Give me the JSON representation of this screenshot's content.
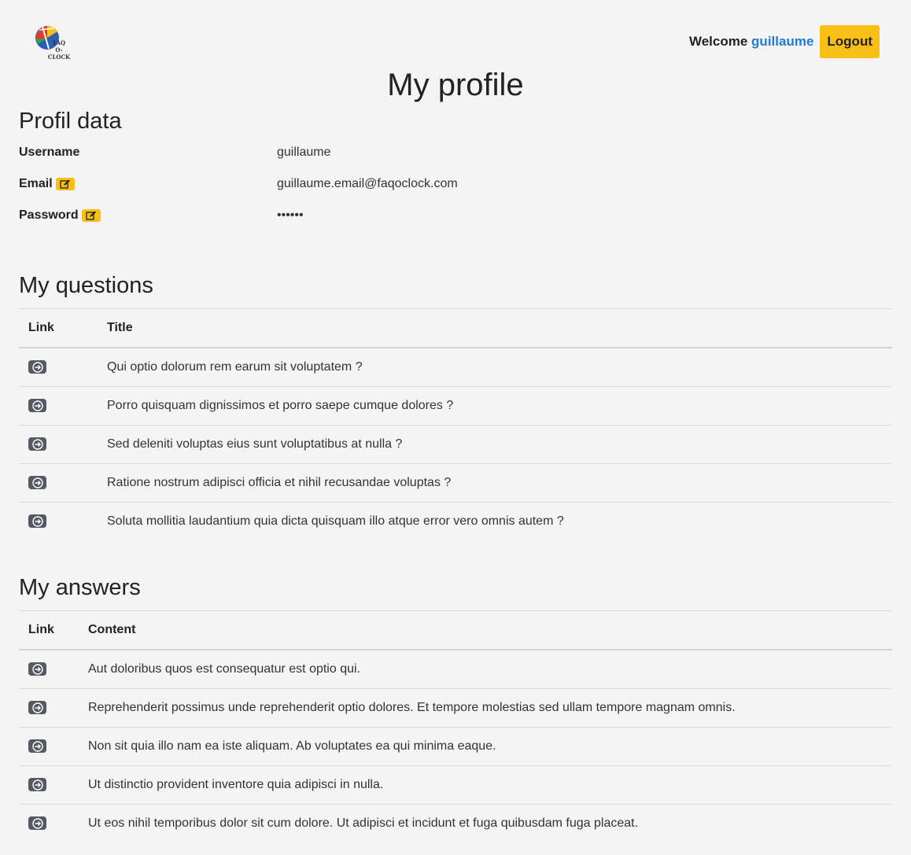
{
  "header": {
    "logo_text_line1": "FAQ",
    "logo_text_line2": "O-CLOCK",
    "welcome_label": "Welcome",
    "username": "guillaume",
    "logout_label": "Logout"
  },
  "page_title": "My profile",
  "profile": {
    "section_title": "Profil data",
    "fields": [
      {
        "label": "Username",
        "value": "guillaume"
      },
      {
        "label": "Email",
        "value": "guillaume.email@faqoclock.com"
      },
      {
        "label": "Password",
        "value": "••••••"
      }
    ]
  },
  "questions": {
    "section_title": "My questions",
    "columns": [
      "Link",
      "Title"
    ],
    "rows": [
      "Qui optio dolorum rem earum sit voluptatem ?",
      "Porro quisquam dignissimos et porro saepe cumque dolores ?",
      "Sed deleniti voluptas eius sunt voluptatibus at nulla ?",
      "Ratione nostrum adipisci officia et nihil recusandae voluptas ?",
      "Soluta mollitia laudantium quia dicta quisquam illo atque error vero omnis autem ?"
    ]
  },
  "answers": {
    "section_title": "My answers",
    "columns": [
      "Link",
      "Content"
    ],
    "rows": [
      "Aut doloribus quos est consequatur est optio qui.",
      "Reprehenderit possimus unde reprehenderit optio dolores. Et tempore molestias sed ullam tempore magnam omnis.",
      "Non sit quia illo nam ea iste aliquam. Ab voluptates ea qui minima eaque.",
      "Ut distinctio provident inventore quia adipisci in nulla.",
      "Ut eos nihil temporibus dolor sit cum dolore. Ut adipisci et incidunt et fuga quibusdam fuga placeat."
    ]
  },
  "colors": {
    "accent": "#f9bf15",
    "link": "#1f7ad6",
    "arrow_button": "#555a62",
    "background": "#f4f4f4"
  },
  "icons": {
    "edit": "pencil-square-icon",
    "row_link": "arrow-right-circle-icon"
  }
}
